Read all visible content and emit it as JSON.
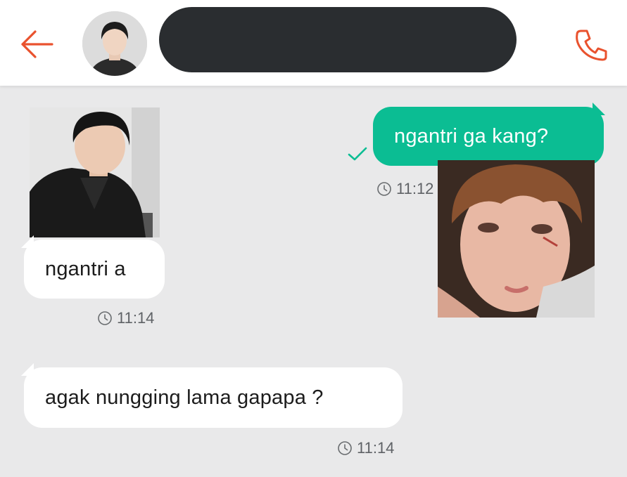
{
  "header": {
    "back_icon": "arrow-left-icon",
    "call_icon": "phone-icon",
    "contact_name": "",
    "accent_color": "#e9522e"
  },
  "messages": [
    {
      "direction": "incoming",
      "type": "image",
      "photo_desc": "selfie"
    },
    {
      "direction": "incoming",
      "type": "text",
      "text": "ngantri a",
      "time": "11:14"
    },
    {
      "direction": "incoming",
      "type": "text",
      "text": "agak nungging lama gapapa ?",
      "time": "11:14"
    },
    {
      "direction": "outgoing",
      "type": "text",
      "text": "ngantri ga kang?",
      "time": "11:12",
      "status_icon": "check-icon"
    },
    {
      "direction": "outgoing",
      "type": "image"
    }
  ],
  "colors": {
    "outgoing_bubble": "#0bbd93",
    "incoming_bubble": "#ffffff",
    "background": "#e9e9ea",
    "check": "#0bbd93"
  }
}
